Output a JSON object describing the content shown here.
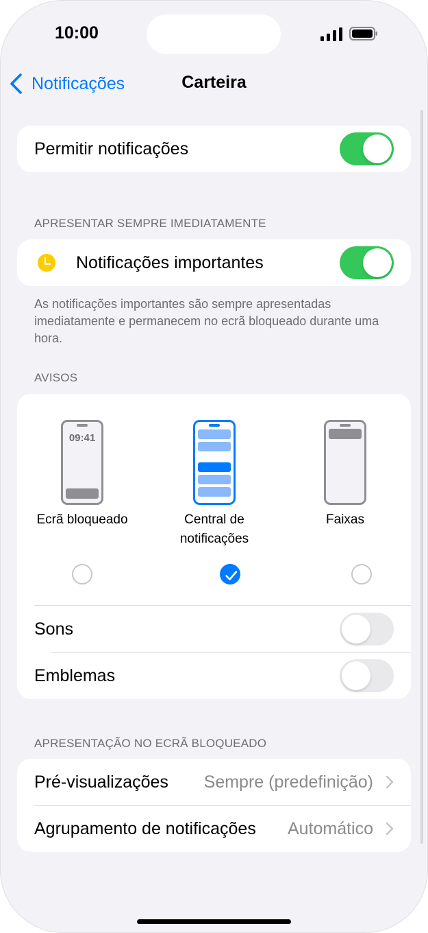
{
  "status_bar": {
    "time": "10:00"
  },
  "nav": {
    "back_label": "Notificações",
    "title": "Carteira"
  },
  "allow": {
    "label": "Permitir notificações",
    "on": true
  },
  "immediate": {
    "header": "APRESENTAR SEMPRE IMEDIATAMENTE",
    "label": "Notificações importantes",
    "on": true,
    "footer": "As notificações importantes são sempre apresentadas imediatamente e permanecem no ecrã bloqueado durante uma hora."
  },
  "alerts": {
    "header": "AVISOS",
    "lock_time": "09:41",
    "options": [
      {
        "label": "Ecrã bloqueado",
        "selected": false
      },
      {
        "label": "Central de notificações",
        "selected": true
      },
      {
        "label": "Faixas",
        "selected": false
      }
    ],
    "sounds": {
      "label": "Sons",
      "on": false
    },
    "badges": {
      "label": "Emblemas",
      "on": false
    }
  },
  "lock_screen": {
    "header": "APRESENTAÇÃO NO ECRÃ BLOQUEADO",
    "previews": {
      "label": "Pré-visualizações",
      "value": "Sempre (predefinição)"
    },
    "grouping": {
      "label": "Agrupamento de notificações",
      "value": "Automático"
    }
  },
  "colors": {
    "accent": "#007aff",
    "toggle_on": "#34c759",
    "important_icon": "#ffcc00"
  }
}
